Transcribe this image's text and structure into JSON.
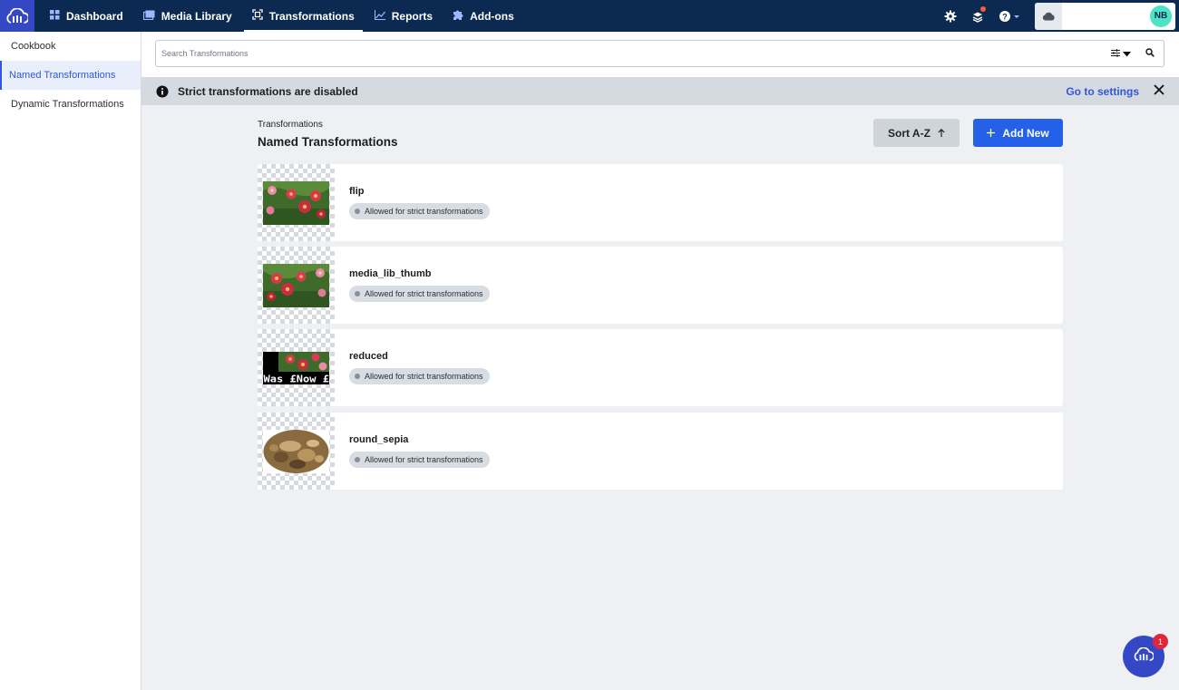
{
  "nav": {
    "items": [
      {
        "label": "Dashboard",
        "icon": "dashboard-icon"
      },
      {
        "label": "Media Library",
        "icon": "media-library-icon"
      },
      {
        "label": "Transformations",
        "icon": "transformations-icon",
        "active": true
      },
      {
        "label": "Reports",
        "icon": "reports-icon"
      },
      {
        "label": "Add-ons",
        "icon": "addons-icon"
      }
    ],
    "avatar_initials": "NB"
  },
  "sidebar": {
    "items": [
      {
        "label": "Cookbook"
      },
      {
        "label": "Named Transformations",
        "active": true
      },
      {
        "label": "Dynamic Transformations"
      }
    ]
  },
  "search": {
    "placeholder": "Search Transformations",
    "value": ""
  },
  "banner": {
    "text": "Strict transformations are disabled",
    "link": "Go to settings"
  },
  "header": {
    "breadcrumb": "Transformations",
    "title": "Named Transformations",
    "sort_label": "Sort A-Z",
    "add_label": "Add New"
  },
  "transformations": [
    {
      "name": "flip",
      "badge": "Allowed for strict transformations",
      "thumb": "flowers-flipped"
    },
    {
      "name": "media_lib_thumb",
      "badge": "Allowed for strict transformations",
      "thumb": "flowers"
    },
    {
      "name": "reduced",
      "badge": "Allowed for strict transformations",
      "thumb": "flowers-price-overlay",
      "overlay_text": "Was £Now £"
    },
    {
      "name": "round_sepia",
      "badge": "Allowed for strict transformations",
      "thumb": "sepia-round"
    }
  ],
  "chat": {
    "badge_count": "1"
  },
  "colors": {
    "topbar": "#0c2a51",
    "accent": "#3157d8",
    "primary_button": "#2561e8",
    "avatar": "#4ee3c4",
    "notification": "#e0263a"
  }
}
